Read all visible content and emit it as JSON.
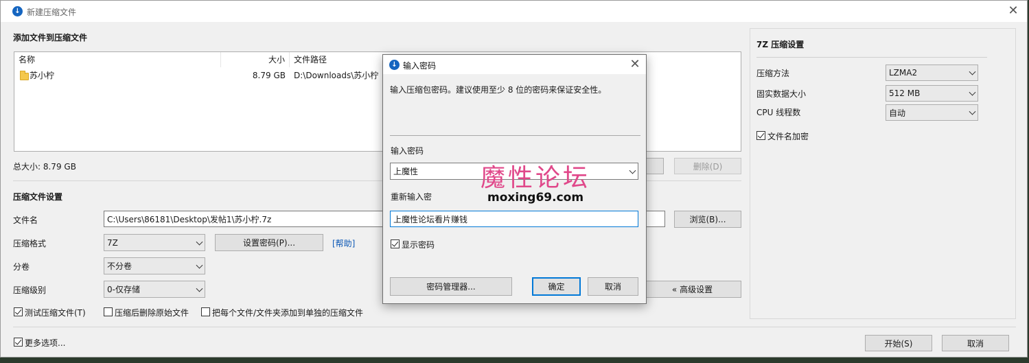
{
  "window": {
    "title": "新建压缩文件"
  },
  "files_section": {
    "title": "添加文件到压缩文件",
    "columns": [
      "名称",
      "大小",
      "文件路径"
    ],
    "rows": [
      {
        "name": "苏小柠",
        "size": "8.79 GB",
        "path": "D:\\Downloads\\苏小柠"
      }
    ],
    "total_size": "总大小: 8.79 GB",
    "delete_button": "删除(D)"
  },
  "archive_settings": {
    "title": "压缩文件设置",
    "filename_label": "文件名",
    "filename_value": "C:\\Users\\86181\\Desktop\\发帖1\\苏小柠.7z",
    "browse_button": "浏览(B)...",
    "format_label": "压缩格式",
    "format_value": "7Z",
    "set_password_button": "设置密码(P)...",
    "help_link": "[帮助]",
    "split_label": "分卷",
    "split_value": "不分卷",
    "level_label": "压缩级别",
    "level_value": "0-仅存储",
    "advanced_button": "« 高级设置",
    "options": [
      {
        "label": "测试压缩文件(T)",
        "checked": true
      },
      {
        "label": "压缩后删除原始文件",
        "checked": false
      },
      {
        "label": "把每个文件/文件夹添加到单独的压缩文件",
        "checked": false
      }
    ]
  },
  "footer": {
    "more_options": "更多选项...",
    "more_options_checked": true,
    "start_button": "开始(S)",
    "cancel_button": "取消"
  },
  "right_panel": {
    "title": "7Z 压缩设置",
    "method_label": "压缩方法",
    "method_value": "LZMA2",
    "solid_label": "固实数据大小",
    "solid_value": "512 MB",
    "threads_label": "CPU 线程数",
    "threads_value": "自动",
    "encrypt_names": "文件名加密",
    "encrypt_names_checked": true
  },
  "password_dialog": {
    "title": "输入密码",
    "instruction": "输入压缩包密码。建议使用至少 8 位的密码来保证安全性。",
    "password_label": "输入密码",
    "password_value": "上魔性",
    "reenter_label": "重新输入密",
    "reenter_value": "上魔性论坛看片赚钱",
    "show_password": "显示密码",
    "show_password_checked": true,
    "manager_button": "密码管理器...",
    "ok_button": "确定",
    "cancel_button": "取消"
  },
  "watermark": {
    "text": "魔性论坛",
    "url": "moxing69.com"
  }
}
